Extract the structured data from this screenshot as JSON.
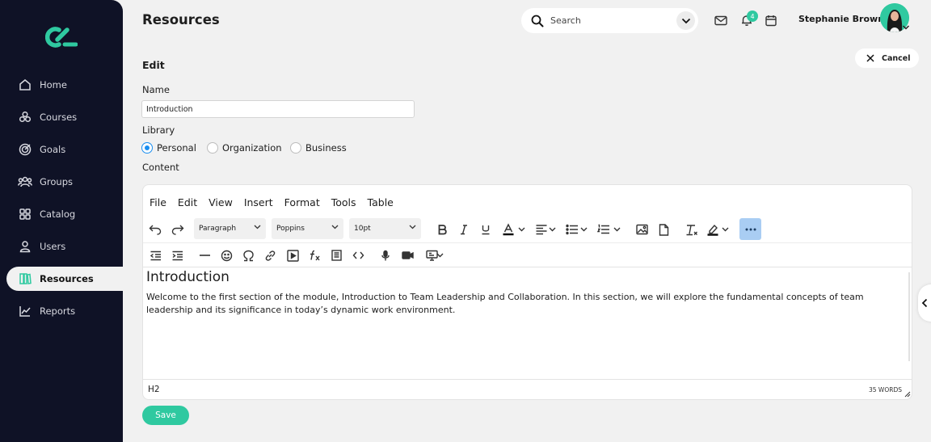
{
  "sidebar": {
    "items": [
      {
        "label": "Home",
        "icon": "home-icon"
      },
      {
        "label": "Courses",
        "icon": "courses-icon"
      },
      {
        "label": "Goals",
        "icon": "target-icon"
      },
      {
        "label": "Groups",
        "icon": "users-group-icon"
      },
      {
        "label": "Catalog",
        "icon": "grid-icon"
      },
      {
        "label": "Users",
        "icon": "user-icon"
      },
      {
        "label": "Resources",
        "icon": "book-icon",
        "active": true
      },
      {
        "label": "Reports",
        "icon": "chart-line-icon"
      }
    ]
  },
  "header": {
    "title": "Resources",
    "search_placeholder": "Search",
    "notification_count": "4",
    "user_name": "Stephanie Brown"
  },
  "form": {
    "heading": "Edit",
    "cancel_label": "Cancel",
    "name_label": "Name",
    "name_value": "Introduction",
    "library_label": "Library",
    "library_options": [
      "Personal",
      "Organization",
      "Business"
    ],
    "library_selected": "Personal",
    "content_label": "Content",
    "save_label": "Save"
  },
  "editor": {
    "menu": [
      "File",
      "Edit",
      "View",
      "Insert",
      "Format",
      "Tools",
      "Table"
    ],
    "block_format": "Paragraph",
    "font_family": "Poppins",
    "font_size": "10pt",
    "heading": "Introduction",
    "body": "Welcome to the first section of the module, Introduction to Team Leadership and Collaboration. In this section, we will explore the fundamental concepts of team leadership and its significance in today’s dynamic work environment.",
    "status_path": "H2",
    "word_count": "35 WORDS"
  },
  "colors": {
    "sidebar_bg": "#0f1226",
    "accent": "#2fc9a0",
    "radio_selected": "#1a8ef0",
    "toolbar_active": "#a9cdf3"
  }
}
